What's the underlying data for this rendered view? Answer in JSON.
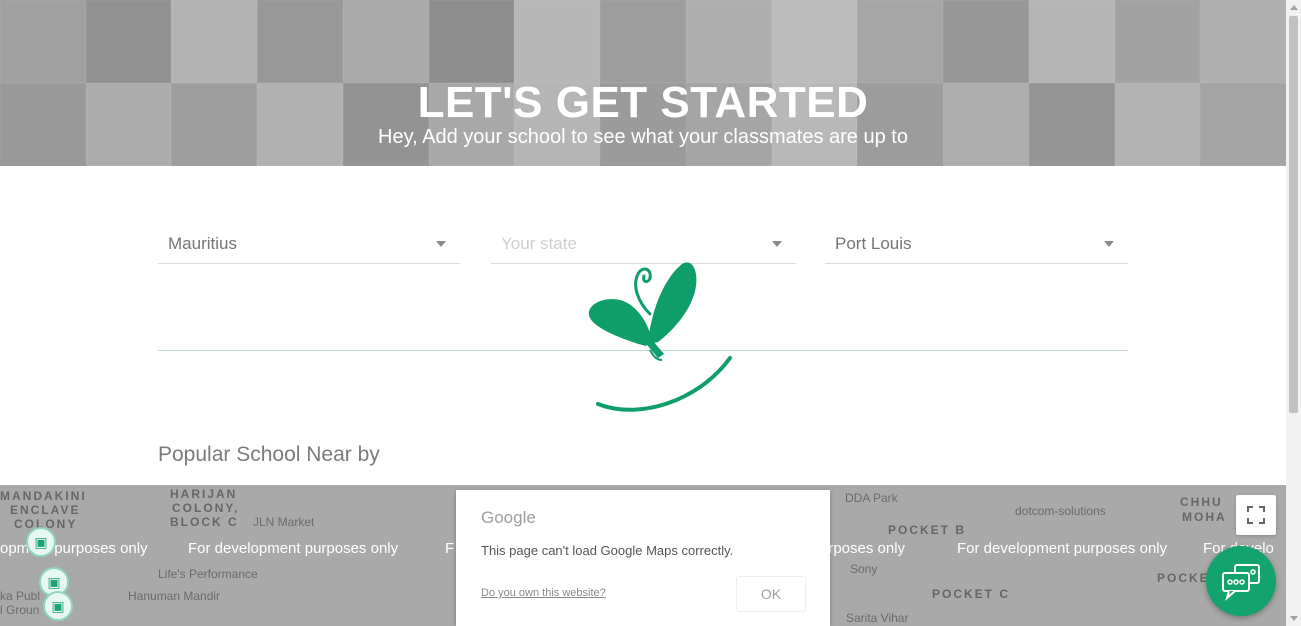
{
  "hero": {
    "title": "LET'S GET STARTED",
    "subtitle": "Hey, Add your school to see what your classmates are up to"
  },
  "form": {
    "country": "Mauritius",
    "state_placeholder": "Your state",
    "city": "Port Louis"
  },
  "section": {
    "popular_title": "Popular School Near by"
  },
  "map": {
    "dev_notice": "For development purposes only",
    "dev_partial_left": "opment purposes only",
    "dev_partial_mid": "F",
    "dev_partial_mid2": "urposes only",
    "dev_partial_right": "For develo",
    "labels": {
      "mandakini1": "MANDAKINI",
      "mandakini2": "ENCLAVE",
      "mandakini3": "COLONY",
      "harijan1": "HARIJAN",
      "harijan2": "COLONY,",
      "harijan3": "BLOCK C",
      "jln": "JLN Market",
      "lifes": "Life's Performance",
      "hanuman": "Hanuman Mandir",
      "ka_publ": "ka Publ",
      "groun": "l Groun",
      "dda": "DDA Park",
      "pocket_b": "POCKET B",
      "dotcom": "dotcom-solutions",
      "sony": "Sony",
      "pocket_c": "POCKET C",
      "sarita": "Sarita Vihar",
      "chhu1": "CHHU",
      "chhu2": "MOHA",
      "pocke": "POCKE"
    }
  },
  "dialog": {
    "brand": "Google",
    "message": "This page can't load Google Maps correctly.",
    "own_link": "Do you own this website?",
    "ok_label": "OK"
  },
  "colors": {
    "brand_green": "#0f9d6a",
    "chat_green": "#12a36e"
  },
  "icons": {
    "loader": "butterfly-logo-icon",
    "chat": "chat-bubbles-icon",
    "fullscreen": "fullscreen-icon",
    "school_pin": "school-pin-icon"
  }
}
